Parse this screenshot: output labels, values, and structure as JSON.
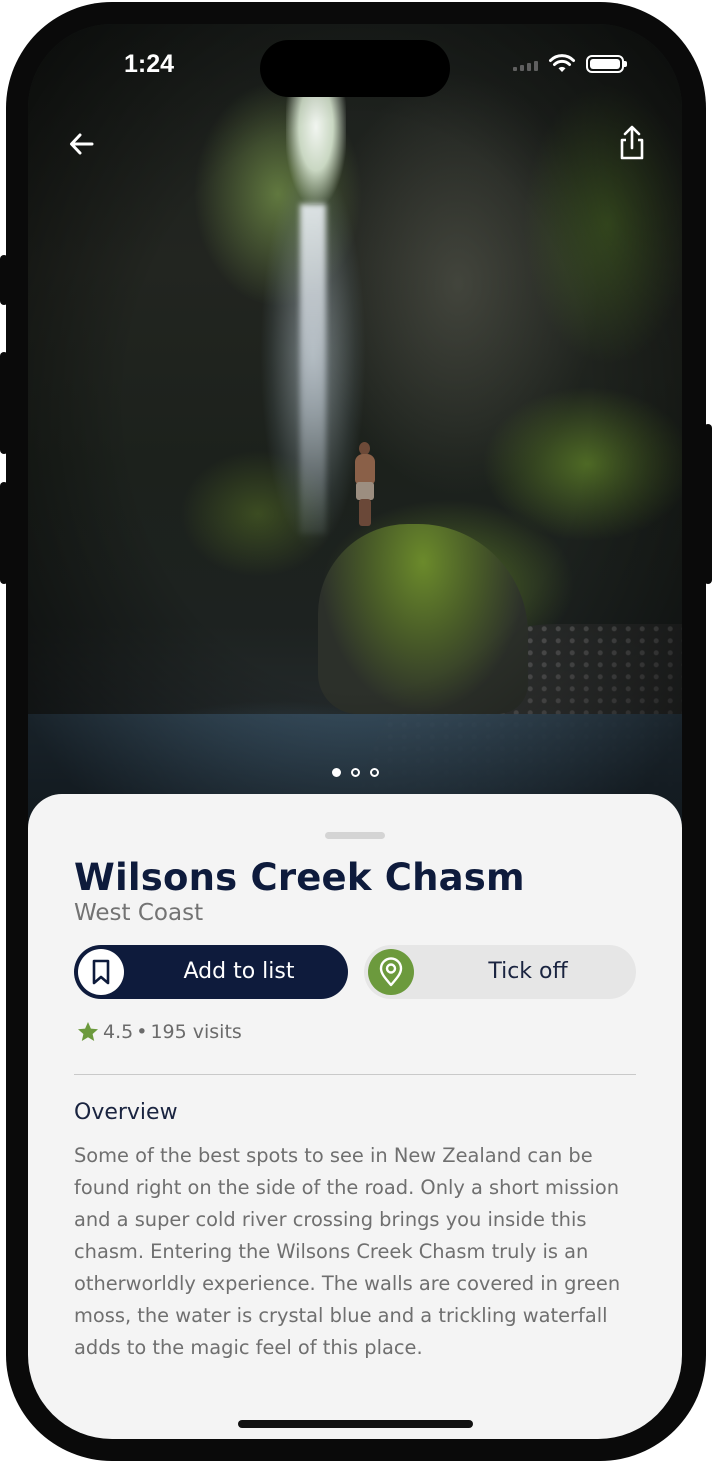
{
  "status_bar": {
    "time": "1:24"
  },
  "hero": {
    "back_icon": "arrow-left-icon",
    "share_icon": "share-icon",
    "page_count": 3,
    "active_page": 1
  },
  "place": {
    "title": "Wilsons Creek Chasm",
    "region": "West Coast",
    "rating": "4.5",
    "separator": "•",
    "visits": "195 visits"
  },
  "actions": {
    "add_label": "Add to list",
    "add_icon": "bookmark-icon",
    "tick_label": "Tick off",
    "tick_icon": "location-pin-icon"
  },
  "overview": {
    "heading": "Overview",
    "body": "Some of the best spots to see in New Zealand can be found right on the side of the road. Only a short mission and a super cold river crossing brings you inside this chasm. Entering the Wilsons Creek Chasm truly is an otherworldly experience. The walls are covered in green moss, the water is crystal blue and a trickling waterfall adds to the magic feel of this place."
  },
  "colors": {
    "primary_navy": "#0e1b3c",
    "accent_green": "#6c9a3d",
    "sheet_bg": "#f4f4f4",
    "muted_text": "#6f6f6f"
  }
}
